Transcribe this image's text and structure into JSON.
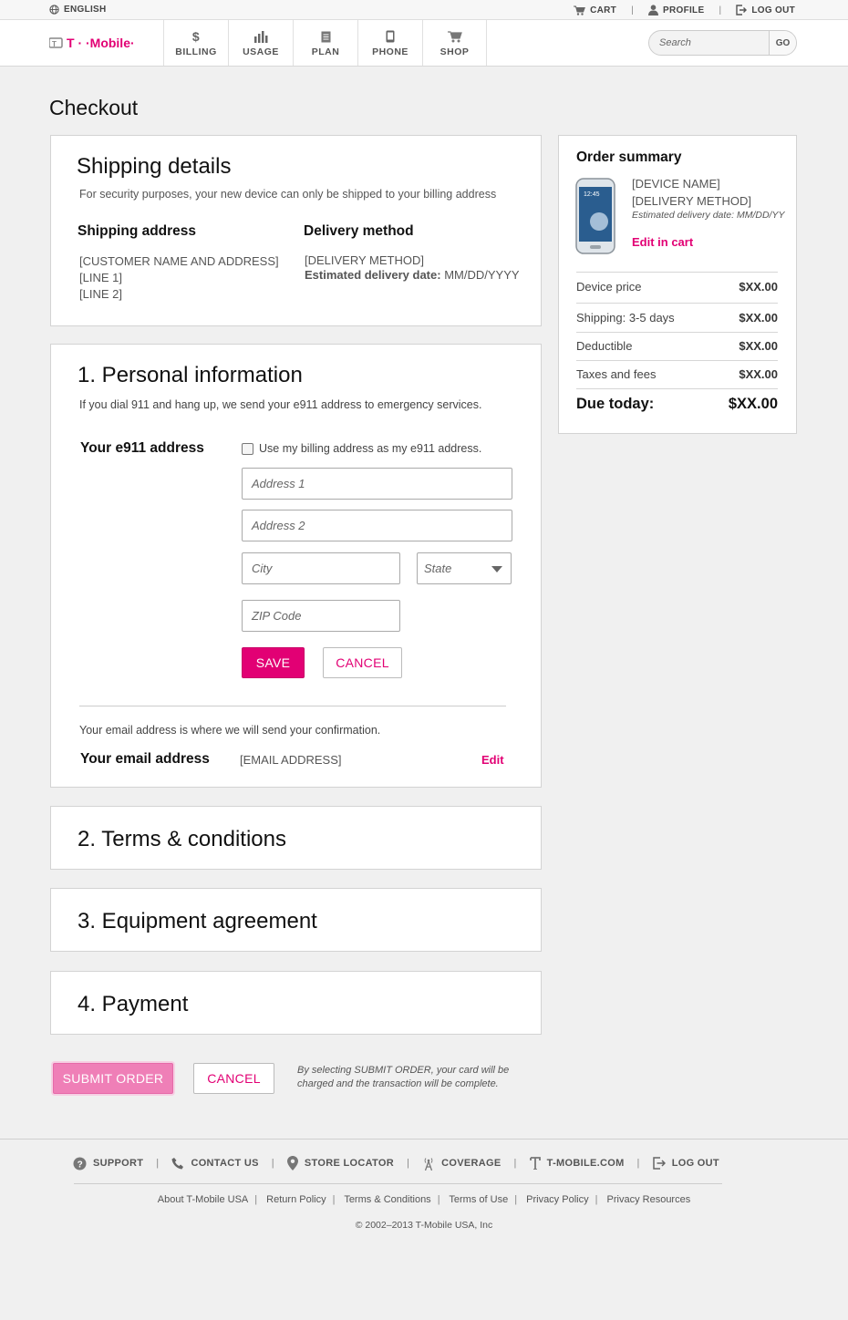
{
  "utility": {
    "language": "ENGLISH",
    "cart": "CART",
    "profile": "PROFILE",
    "logout": "LOG OUT"
  },
  "header": {
    "brand": "T · · Mobile ·",
    "nav": [
      {
        "label": "BILLING",
        "icon": "dollar-icon"
      },
      {
        "label": "USAGE",
        "icon": "bar-chart-icon"
      },
      {
        "label": "PLAN",
        "icon": "document-icon"
      },
      {
        "label": "PHONE",
        "icon": "phone-icon"
      },
      {
        "label": "SHOP",
        "icon": "shopping-cart-icon"
      }
    ],
    "search_placeholder": "Search",
    "search_button": "GO"
  },
  "page_title": "Checkout",
  "shipping": {
    "title": "Shipping details",
    "subtitle": "For security purposes, your new device can only be shipped to your billing address",
    "address_heading": "Shipping address",
    "address_lines": [
      "[CUSTOMER NAME AND ADDRESS]",
      "[LINE 1]",
      "[LINE 2]"
    ],
    "delivery_heading": "Delivery method",
    "delivery_method": "[DELIVERY METHOD]",
    "estimated_label": "Estimated delivery date:",
    "estimated_value": "MM/DD/YYYY"
  },
  "personal": {
    "title": "1. Personal information",
    "subtitle": "If you dial 911 and hang up, we send your e911 address to emergency services.",
    "e911_label": "Your e911 address",
    "use_billing": "Use my billing address as my e911 address.",
    "address1_placeholder": "Address 1",
    "address2_placeholder": "Address 2",
    "city_placeholder": "City",
    "state_placeholder": "State",
    "zip_placeholder": "ZIP Code",
    "save": "SAVE",
    "cancel": "CANCEL",
    "email_note": "Your email address is where we will send your confirmation.",
    "email_label": "Your email address",
    "email_value": "[EMAIL ADDRESS]",
    "edit": "Edit"
  },
  "sections": {
    "terms": "2. Terms & conditions",
    "equipment": "3. Equipment agreement",
    "payment": "4. Payment"
  },
  "actions": {
    "submit": "SUBMIT ORDER",
    "cancel": "CANCEL",
    "disclaimer": "By selecting SUBMIT ORDER, your card will be charged and the transaction will be complete."
  },
  "summary": {
    "title": "Order summary",
    "device_name": "[DEVICE NAME]",
    "delivery_method": "[DELIVERY METHOD]",
    "estimated": "Estimated delivery date: MM/DD/YY",
    "phone_time": "12:45",
    "edit_cart": "Edit in cart",
    "rows": [
      {
        "label": "Device price",
        "amount": "$XX.00"
      },
      {
        "label": "Shipping: 3-5 days",
        "amount": "$XX.00"
      },
      {
        "label": "Deductible",
        "amount": "$XX.00"
      },
      {
        "label": "Taxes and fees",
        "amount": "$XX.00"
      }
    ],
    "total_label": "Due today:",
    "total_amount": "$XX.00"
  },
  "footer": {
    "links": [
      {
        "label": "SUPPORT",
        "icon": "question-circle-icon"
      },
      {
        "label": "CONTACT US",
        "icon": "telephone-icon"
      },
      {
        "label": "STORE LOCATOR",
        "icon": "map-pin-icon"
      },
      {
        "label": "COVERAGE",
        "icon": "signal-tower-icon"
      },
      {
        "label": "T-MOBILE.COM",
        "icon": "tmobile-t-icon"
      },
      {
        "label": "LOG OUT",
        "icon": "logout-icon"
      }
    ],
    "legal": [
      "About T-Mobile USA",
      "Return Policy",
      "Terms & Conditions",
      "Terms of Use",
      "Privacy Policy",
      "Privacy Resources"
    ],
    "copyright": "© 2002–2013 T-Mobile USA, Inc"
  }
}
